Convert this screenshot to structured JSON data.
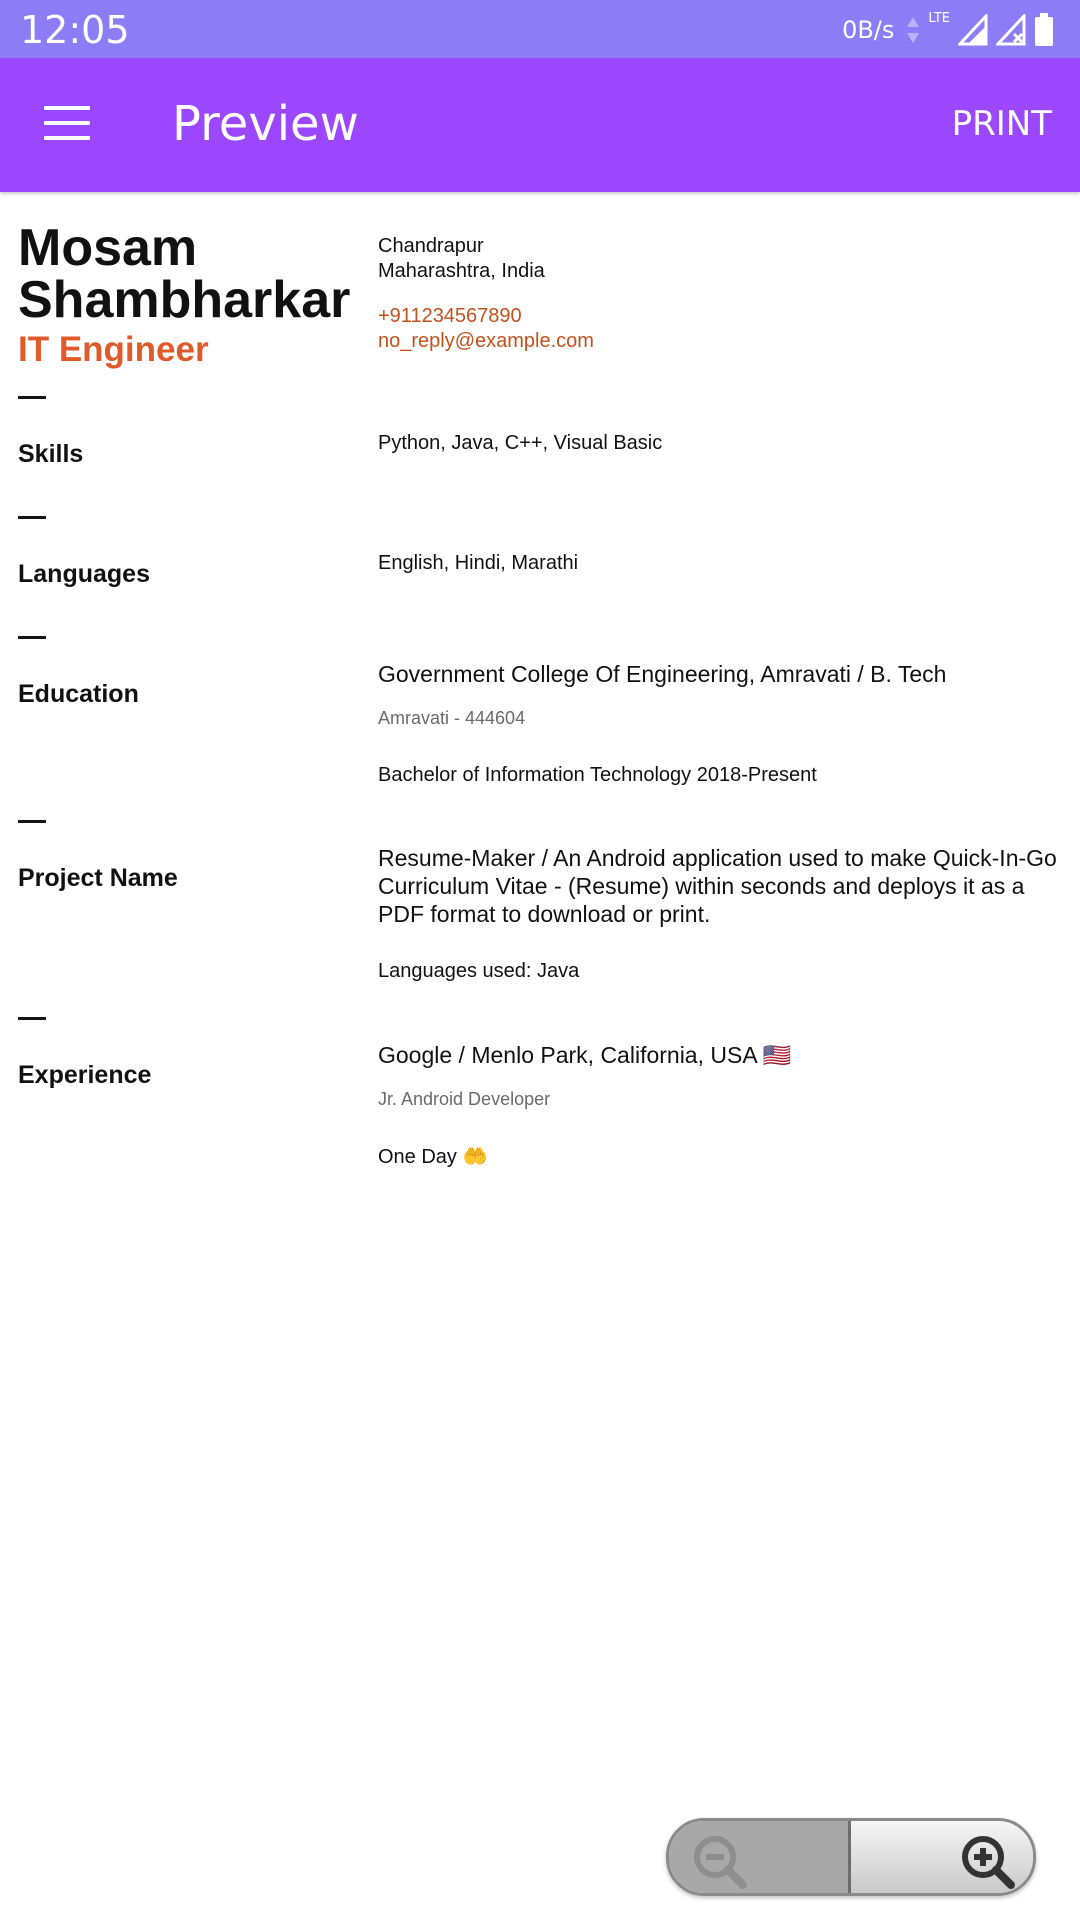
{
  "status_bar": {
    "time": "12:05",
    "net_speed": "0B/s",
    "network_type": "LTE"
  },
  "app_bar": {
    "title": "Preview",
    "print_label": "PRINT"
  },
  "resume": {
    "name_line1": "Mosam",
    "name_line2": "Shambharkar",
    "job_title": "IT Engineer",
    "city": "Chandrapur",
    "state_country": "Maharashtra, India",
    "phone": "+911234567890",
    "email": "no_reply@example.com",
    "skills": {
      "label": "Skills",
      "value": "Python, Java, C++, Visual Basic"
    },
    "languages": {
      "label": "Languages",
      "value": "English, Hindi, Marathi"
    },
    "education": {
      "label": "Education",
      "institution": "Government College Of Engineering, Amravati / B. Tech",
      "location": "Amravati - 444604",
      "degree": "Bachelor of Information Technology 2018-Present"
    },
    "project": {
      "label": "Project Name",
      "description": "Resume-Maker / An Android application used to make Quick-In-Go Curriculum Vitae - (Resume) within seconds and deploys it as a PDF format to download or print.",
      "languages_used": "Languages used: Java"
    },
    "experience": {
      "label": "Experience",
      "company": "Google / Menlo Park, California, USA 🇺🇸",
      "role": "Jr. Android Developer",
      "duration": "One Day 🤲"
    }
  },
  "icons": {
    "menu": "menu-icon",
    "zoom_out": "zoom-out-icon",
    "zoom_in": "zoom-in-icon"
  },
  "colors": {
    "status_bar": "#8c7cf6",
    "app_bar": "#9a47fe",
    "accent": "#e05a2a",
    "link": "#c2521c"
  }
}
